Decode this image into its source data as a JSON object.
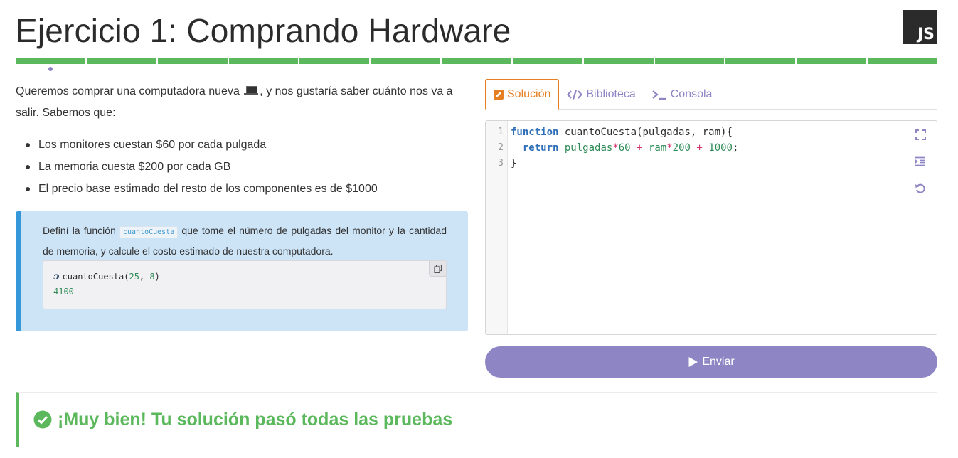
{
  "header": {
    "title": "Ejercicio 1: Comprando Hardware",
    "language_badge": "JS",
    "progress_segments": 13
  },
  "description": {
    "intro_before_icon": "Queremos comprar una computadora nueva",
    "intro_icon": "laptop-icon",
    "intro_after_icon": ", y nos gustaría saber cuánto nos va a salir. Sabemos que:",
    "items": [
      "Los monitores cuestan $60 por cada pulgada",
      "La memoria cuesta $200 por cada GB",
      "El precio base estimado del resto de los componentes es de $1000"
    ]
  },
  "callout": {
    "text_before": "Definí la función",
    "function_name": "cuantoCuesta",
    "text_after": "que tome el número de pulgadas del monitor y la cantidad de memoria, y calcule el costo estimado de nuestra computadora.",
    "example": {
      "call": "cuantoCuesta",
      "arg1": "25",
      "arg2": "8",
      "result": "4100"
    }
  },
  "tabs": [
    {
      "label": "Solución",
      "icon": "edit-icon",
      "active": true
    },
    {
      "label": "Biblioteca",
      "icon": "code-icon",
      "active": false
    },
    {
      "label": "Consola",
      "icon": "terminal-icon",
      "active": false
    }
  ],
  "editor": {
    "line_numbers": [
      "1",
      "2",
      "3"
    ],
    "line1": {
      "keyword": "function",
      "signature": " cuantoCuesta(pulgadas, ram){"
    },
    "line2": {
      "keyword": "return",
      "a": "pulgadas",
      "m1": "*",
      "n1": "60",
      "p1": "+",
      "b": "ram",
      "m2": "*",
      "n2": "200",
      "p2": "+",
      "n3": "1000",
      "end": ";"
    },
    "line3": "}"
  },
  "submit": {
    "label": "Enviar",
    "icon": "play-icon"
  },
  "result": {
    "text": "¡Muy bien! Tu solución pasó todas las pruebas",
    "icon": "check-circle-icon"
  },
  "colors": {
    "accent": "#8e86c4",
    "success": "#5cb85c",
    "active_tab": "#e67e22",
    "callout_bg": "#cde4f7",
    "callout_border": "#3498db"
  }
}
